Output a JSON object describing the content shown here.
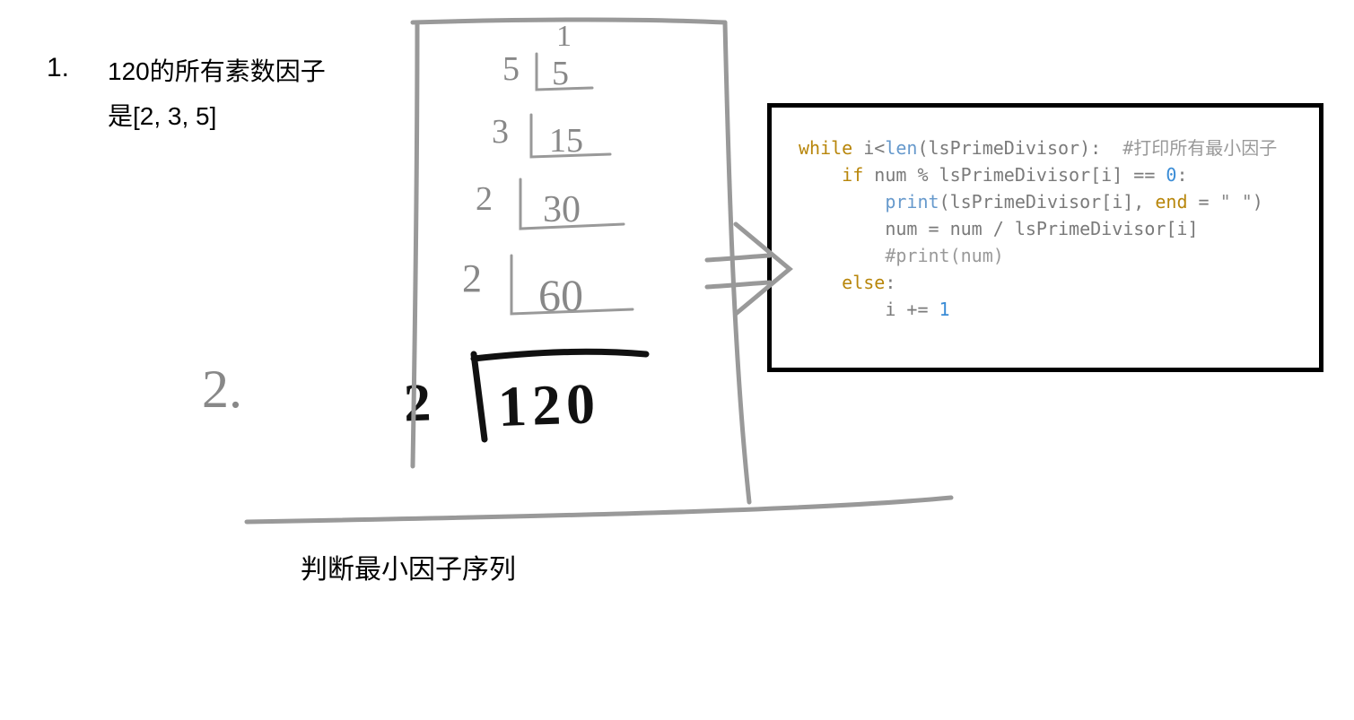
{
  "marker1": "1.",
  "text_line1": "120的所有素数因子",
  "text_line2": "是[2, 3, 5]",
  "marker2": "2.",
  "caption": "判断最小因子序列",
  "division": {
    "top_quotient": "1",
    "rows": [
      {
        "divisor": "5",
        "value": "5"
      },
      {
        "divisor": "3",
        "value": "15"
      },
      {
        "divisor": "2",
        "value": "30"
      },
      {
        "divisor": "2",
        "value": "60"
      },
      {
        "divisor": "2",
        "value": "120"
      }
    ]
  },
  "code": {
    "l1_kw": "while",
    "l1_rest_a": " i<",
    "l1_fn": "len",
    "l1_rest_b": "(lsPrimeDivisor):  ",
    "l1_comment": "#打印所有最小因子",
    "l2_kw": "if",
    "l2_rest": " num % lsPrimeDivisor[i] == ",
    "l2_lit": "0",
    "l2_colon": ":",
    "l3_fn": "print",
    "l3_rest_a": "(lsPrimeDivisor[i], ",
    "l3_kw": "end",
    "l3_rest_b": " = ",
    "l3_str": "\" \"",
    "l3_rest_c": ")",
    "l4": "num = num / lsPrimeDivisor[i]",
    "l5": "#print(num)",
    "l6_kw": "else",
    "l6_colon": ":",
    "l7_a": "i += ",
    "l7_lit": "1"
  }
}
